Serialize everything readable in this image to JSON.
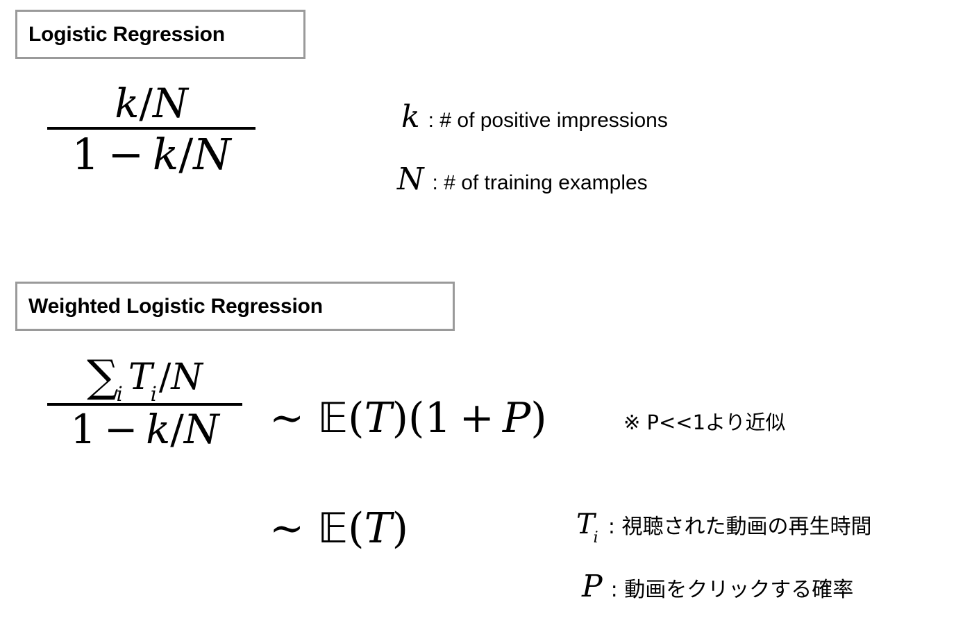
{
  "sections": [
    {
      "heading": "Logistic Regression",
      "formula": {
        "numerator": "k/N",
        "denominator": "1 − k/N",
        "latex": "\\frac{k/N}{1-k/N}"
      },
      "legend": [
        {
          "symbol": "k",
          "separator": ":",
          "description": "# of positive impressions"
        },
        {
          "symbol": "N",
          "separator": ":",
          "description": "# of training examples"
        }
      ]
    },
    {
      "heading": "Weighted Logistic Regression",
      "formula": {
        "numerator": "∑i Ti/N",
        "numerator_sum": "∑",
        "numerator_sum_index": "i",
        "numerator_rest": "T",
        "numerator_rest_index": "i",
        "numerator_tail": "/N",
        "denominator": "1 − k/N",
        "latex": "\\frac{\\sum_i T_i/N}{1-k/N}"
      },
      "approximations": [
        {
          "relation": "∼",
          "expression": "𝔼(T)(1 + P)",
          "latex": "\\sim \\mathbb{E}(T)(1+P)"
        },
        {
          "relation": "∼",
          "expression": "𝔼(T)",
          "latex": "\\sim \\mathbb{E}(T)"
        }
      ],
      "note": "※ P<<1より近似",
      "legend": [
        {
          "symbol": "T",
          "symbol_index": "i",
          "separator": ":",
          "description": "視聴された動画の再生時間"
        },
        {
          "symbol": "P",
          "symbol_index": "",
          "separator": ":",
          "description": "動画をクリックする確率"
        }
      ]
    }
  ],
  "math_glyphs": {
    "blackboard_E": "𝔼",
    "sum": "∑",
    "tilde": "∼",
    "minus": "−",
    "plus": "+",
    "slash": "/",
    "one": "1",
    "open_paren": "(",
    "close_paren": ")",
    "k": "k",
    "N": "N",
    "T": "T",
    "P": "P",
    "i": "i"
  },
  "colors": {
    "background": "#ffffff",
    "text": "#000000",
    "box_border": "#9a9a9a"
  }
}
